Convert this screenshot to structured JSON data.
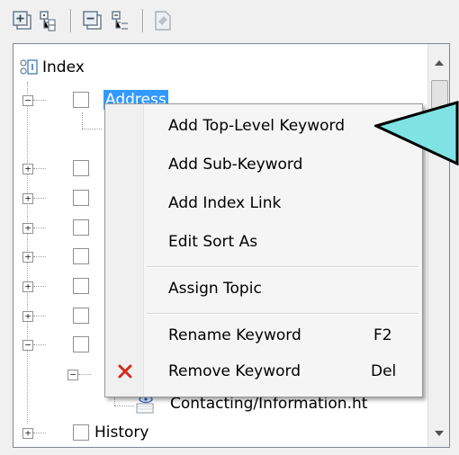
{
  "toolbar": {
    "icons": [
      "add-index-keyword-icon",
      "add-sub-keyword-icon",
      "remove-icon",
      "collapse-tree-icon",
      "topic-icon"
    ]
  },
  "tree": {
    "root_label": "Index",
    "selected_label": "Address",
    "expand_glyph": "+",
    "collapse_glyph": "−",
    "leaf_label": "Contacting/Information.ht",
    "history_label": "History"
  },
  "context_menu": {
    "items": [
      {
        "label": "Add Top-Level Keyword",
        "shortcut": ""
      },
      {
        "label": "Add Sub-Keyword",
        "shortcut": ""
      },
      {
        "label": "Add Index Link",
        "shortcut": ""
      },
      {
        "label": "Edit Sort As",
        "shortcut": ""
      },
      {
        "label": "Assign Topic",
        "shortcut": ""
      },
      {
        "label": "Rename Keyword",
        "shortcut": "F2"
      },
      {
        "label": "Remove Keyword",
        "shortcut": "Del"
      }
    ],
    "remove_icon_color": "#d42a1c"
  },
  "colors": {
    "selection": "#3399ff",
    "callout_fill": "#7fe3e3"
  }
}
